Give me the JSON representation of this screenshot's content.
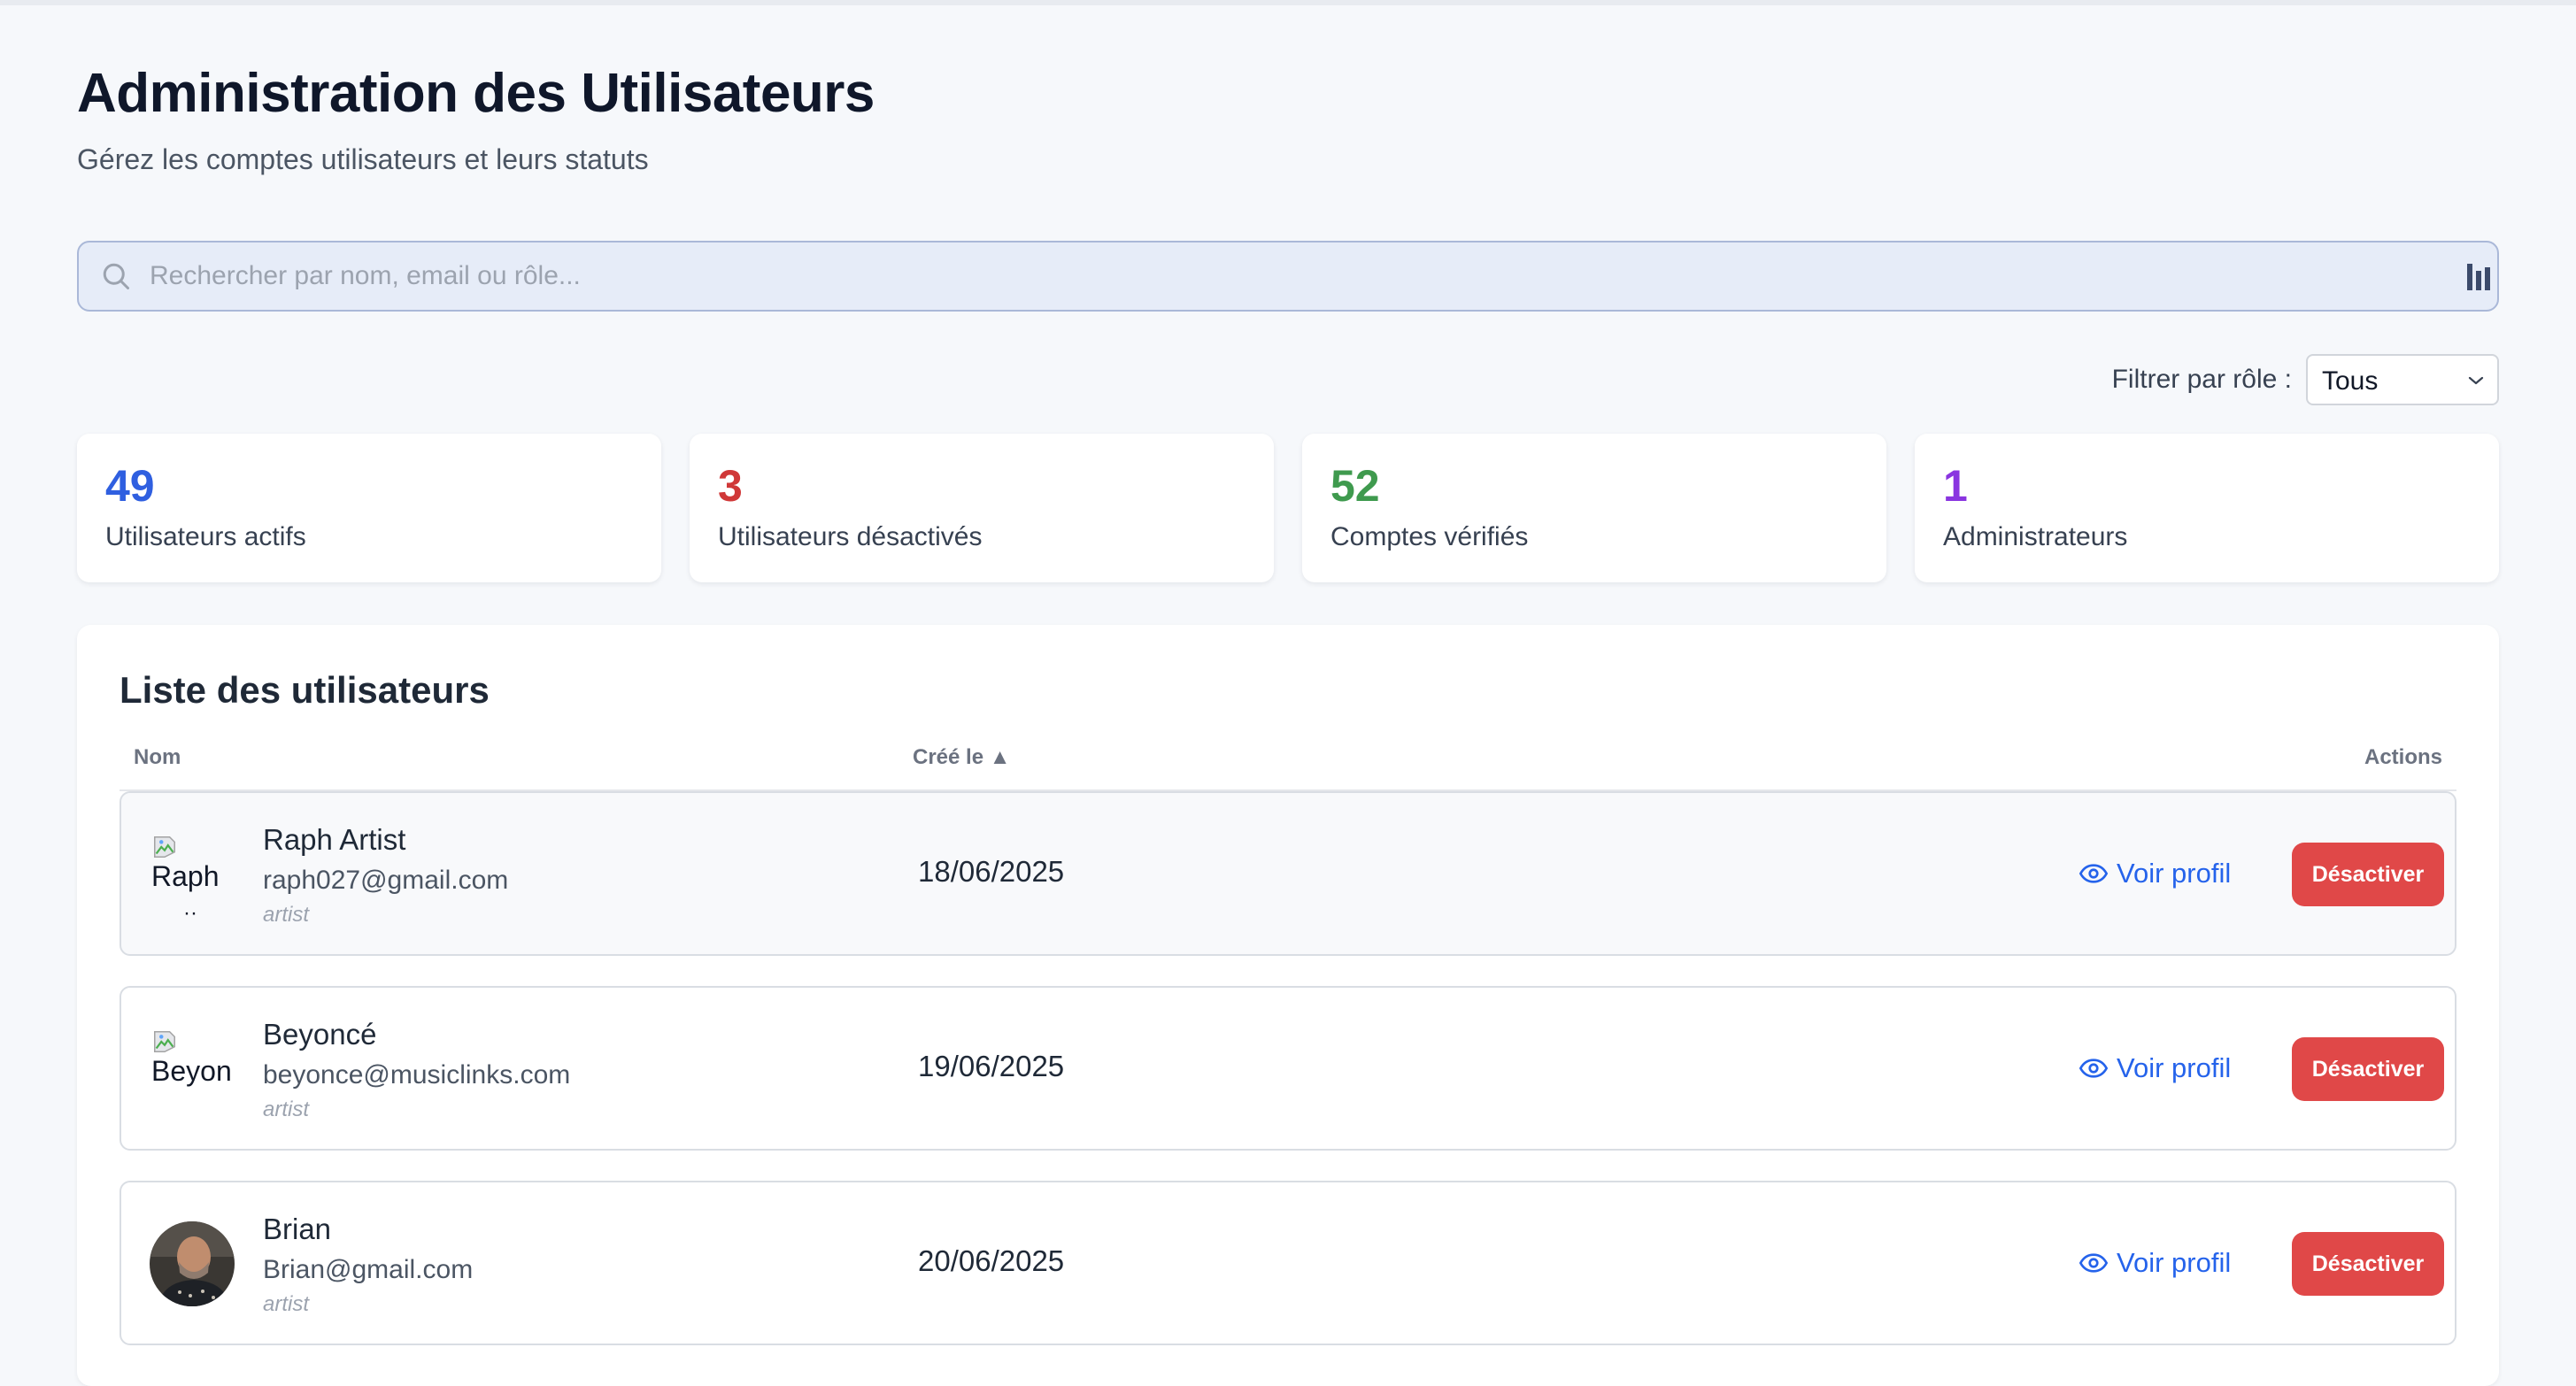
{
  "page": {
    "title": "Administration des Utilisateurs",
    "subtitle": "Gérez les comptes utilisateurs et leurs statuts"
  },
  "search": {
    "placeholder": "Rechercher par nom, email ou rôle...",
    "value": ""
  },
  "filter": {
    "label": "Filtrer par rôle :",
    "selected": "Tous"
  },
  "stats": [
    {
      "value": "49",
      "label": "Utilisateurs actifs",
      "color": "#2f5fe0"
    },
    {
      "value": "3",
      "label": "Utilisateurs désactivés",
      "color": "#d03838"
    },
    {
      "value": "52",
      "label": "Comptes vérifiés",
      "color": "#3f9a4e"
    },
    {
      "value": "1",
      "label": "Administrateurs",
      "color": "#8a35e0"
    }
  ],
  "list": {
    "title": "Liste des utilisateurs",
    "columns": {
      "name": "Nom",
      "created": "Créé le ▲",
      "actions": "Actions"
    },
    "rows": [
      {
        "alt": "Raph",
        "name": "Raph Artist",
        "email": "raph027@gmail.com",
        "role": "artist",
        "created": "18/06/2025",
        "view_label": "Voir profil",
        "action_label": "Désactiver"
      },
      {
        "alt": "Beyon",
        "name": "Beyoncé",
        "email": "beyonce@musiclinks.com",
        "role": "artist",
        "created": "19/06/2025",
        "view_label": "Voir profil",
        "action_label": "Désactiver"
      },
      {
        "name": "Brian",
        "email": "Brian@gmail.com",
        "role": "artist",
        "created": "20/06/2025",
        "view_label": "Voir profil",
        "action_label": "Désactiver"
      }
    ]
  },
  "colors": {
    "primary_link": "#2563eb",
    "danger": "#e04848",
    "background": "#f6f8fb"
  }
}
